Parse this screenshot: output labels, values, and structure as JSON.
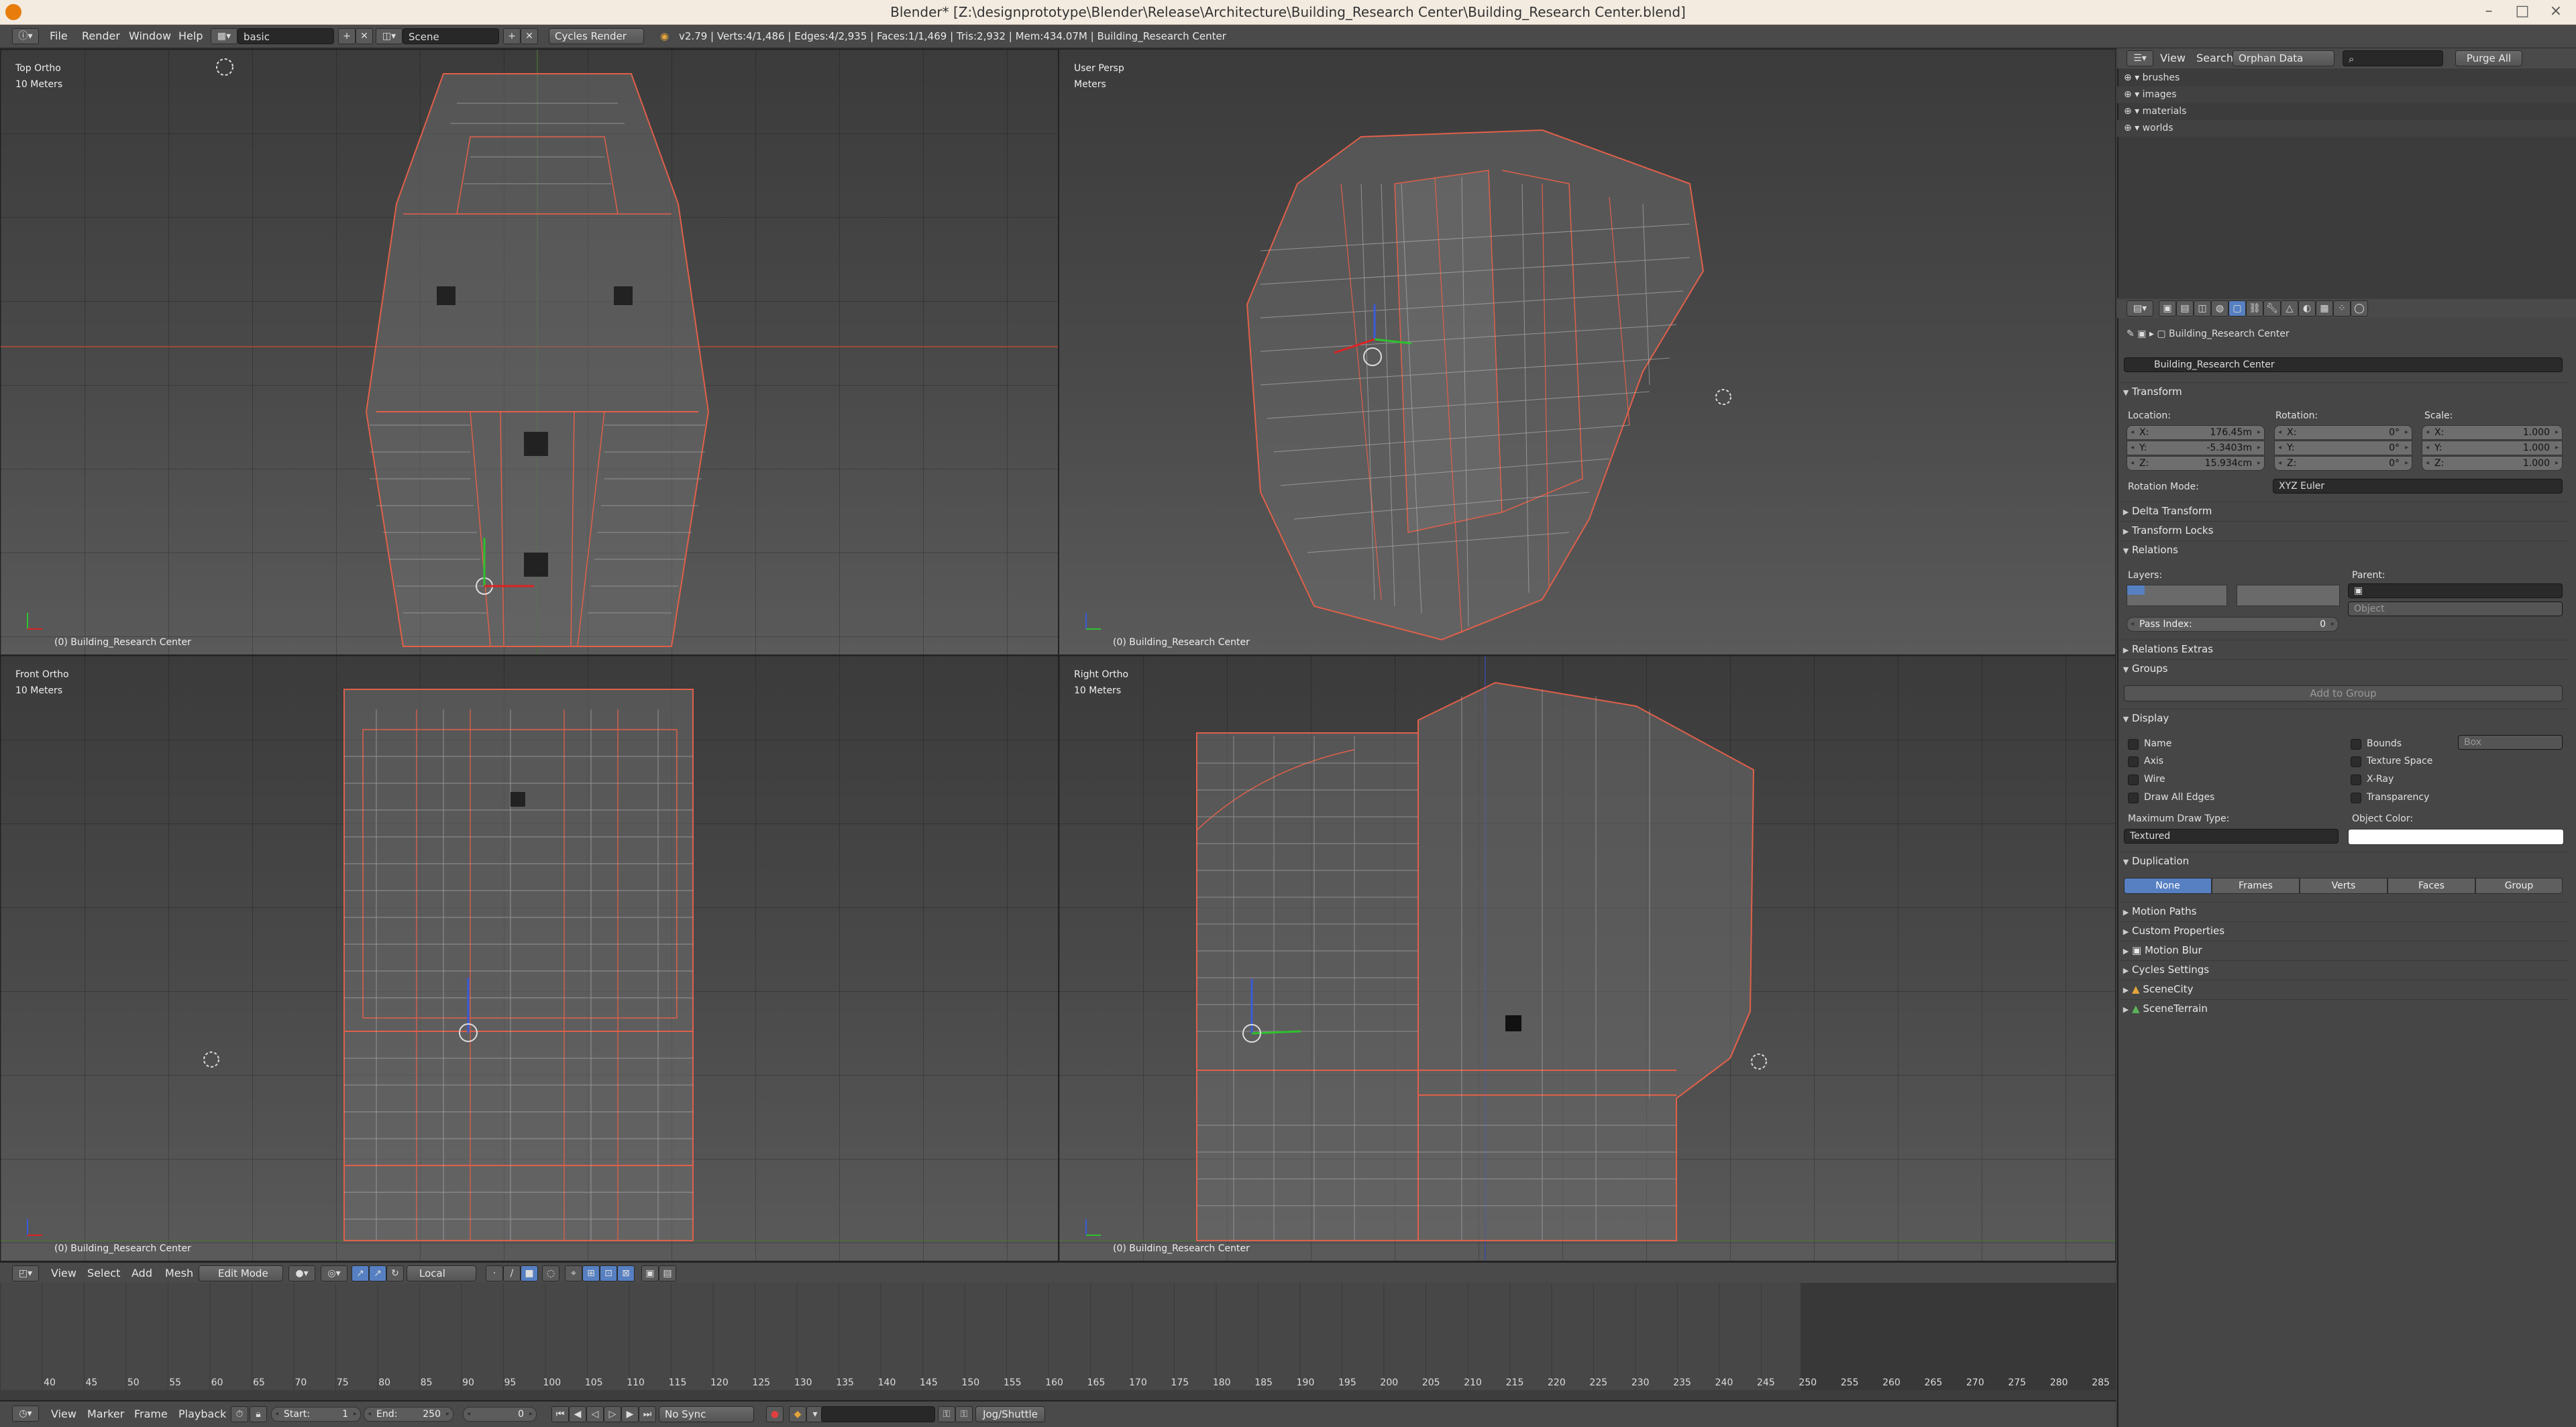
{
  "window": {
    "title": "Blender* [Z:\\designprototype\\Blender\\Release\\Architecture\\Building_Research Center\\Building_Research Center.blend]",
    "controls": [
      "–",
      "□",
      "×"
    ]
  },
  "info_header": {
    "menus": [
      "File",
      "Render",
      "Window",
      "Help"
    ],
    "screen_layout": "basic",
    "scene": "Scene",
    "render_engine": "Cycles Render",
    "stats": "v2.79 | Verts:4/1,486 | Edges:4/2,935 | Faces:1/1,469 | Tris:2,932 | Mem:434.07M | Building_Research Center"
  },
  "viewports": [
    {
      "view": "Top Ortho",
      "scale": "10 Meters",
      "object": "(0) Building_Research Center"
    },
    {
      "view": "User Persp",
      "scale": "Meters",
      "object": "(0) Building_Research Center"
    },
    {
      "view": "Front Ortho",
      "scale": "10 Meters",
      "object": "(0) Building_Research Center"
    },
    {
      "view": "Right Ortho",
      "scale": "10 Meters",
      "object": "(0) Building_Research Center"
    }
  ],
  "view3d_header": {
    "menus": [
      "View",
      "Select",
      "Add",
      "Mesh"
    ],
    "mode": "Edit Mode",
    "orientation": "Local"
  },
  "timeline": {
    "ticks": [
      "40",
      "45",
      "50",
      "55",
      "60",
      "65",
      "70",
      "75",
      "80",
      "85",
      "90",
      "95",
      "100",
      "105",
      "110",
      "115",
      "120",
      "125",
      "130",
      "135",
      "140",
      "145",
      "150",
      "155",
      "160",
      "165",
      "170",
      "175",
      "180",
      "185",
      "190",
      "195",
      "200",
      "205",
      "210",
      "215",
      "220",
      "225",
      "230",
      "235",
      "240",
      "245",
      "250",
      "255",
      "260",
      "265",
      "270",
      "275",
      "280",
      "285"
    ],
    "menus": [
      "View",
      "Marker",
      "Frame",
      "Playback"
    ],
    "start_label": "Start:",
    "start_value": "1",
    "end_label": "End:",
    "end_value": "250",
    "current_frame": "0",
    "sync": "No Sync",
    "jog": "Jog/Shuttle"
  },
  "outliner": {
    "menus": [
      "View",
      "Search"
    ],
    "display_mode": "Orphan Data",
    "purge_label": "Purge All",
    "items": [
      "brushes",
      "images",
      "materials",
      "worlds"
    ]
  },
  "properties": {
    "object_path": "Building_Research Center",
    "object_name": "Building_Research Center",
    "transform": {
      "title": "Transform",
      "location_label": "Location:",
      "rotation_label": "Rotation:",
      "scale_label": "Scale:",
      "location": [
        {
          "k": "X:",
          "v": "176.45m"
        },
        {
          "k": "Y:",
          "v": "-5.3403m"
        },
        {
          "k": "Z:",
          "v": "15.934cm"
        }
      ],
      "rotation": [
        {
          "k": "X:",
          "v": "0°"
        },
        {
          "k": "Y:",
          "v": "0°"
        },
        {
          "k": "Z:",
          "v": "0°"
        }
      ],
      "scale": [
        {
          "k": "X:",
          "v": "1.000"
        },
        {
          "k": "Y:",
          "v": "1.000"
        },
        {
          "k": "Z:",
          "v": "1.000"
        }
      ],
      "rotation_mode_label": "Rotation Mode:",
      "rotation_mode": "XYZ Euler"
    },
    "collapsed_1": [
      "Delta Transform",
      "Transform Locks"
    ],
    "relations": {
      "title": "Relations",
      "layers_label": "Layers:",
      "parent_label": "Parent:",
      "parent_type": "Object",
      "pass_index_label": "Pass Index:",
      "pass_index": "0"
    },
    "relations_extras": "Relations Extras",
    "groups": {
      "title": "Groups",
      "add": "Add to Group"
    },
    "display": {
      "title": "Display",
      "left": [
        "Name",
        "Axis",
        "Wire",
        "Draw All Edges"
      ],
      "right": [
        "Bounds",
        "Texture Space",
        "X-Ray",
        "Transparency"
      ],
      "bounds_type": "Box",
      "max_draw_label": "Maximum Draw Type:",
      "max_draw": "Textured",
      "object_color_label": "Object Color:"
    },
    "duplication": {
      "title": "Duplication",
      "options": [
        "None",
        "Frames",
        "Verts",
        "Faces",
        "Group"
      ],
      "active": "None"
    },
    "collapsed_2": [
      "Motion Paths",
      "Custom Properties",
      "Motion Blur",
      "Cycles Settings",
      "SceneCity",
      "SceneTerrain"
    ]
  }
}
